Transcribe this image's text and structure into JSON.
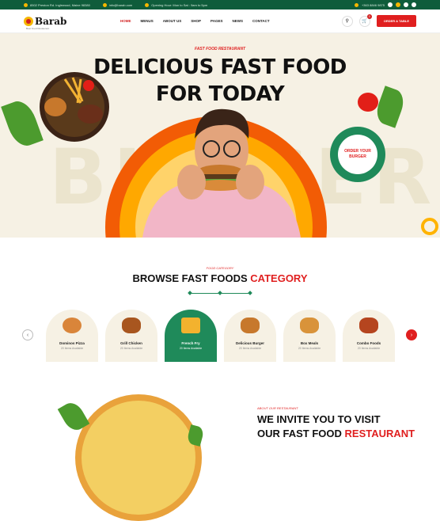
{
  "topbar": {
    "address": "8502 Preston Rd. Inglewood, Maine 98380",
    "email": "info@barab.com",
    "hours": "Opening Hour: Mon to Sat : 9am to 5pm",
    "phone": "+363 8846 9875"
  },
  "header": {
    "logo": "Barab",
    "logo_tagline": "Best Food Restaurant",
    "nav": [
      {
        "label": "HOME",
        "active": true
      },
      {
        "label": "MENUS",
        "active": false
      },
      {
        "label": "ABOUT US",
        "active": false
      },
      {
        "label": "SHOP",
        "active": false
      },
      {
        "label": "PAGES",
        "active": false
      },
      {
        "label": "NEWS",
        "active": false
      },
      {
        "label": "CONTACT",
        "active": false
      }
    ],
    "cart_count": "0",
    "order_button": "ORDER A TABLE"
  },
  "hero": {
    "kicker": "FAST FOOD RESTAURANT",
    "title_line1": "DELICIOUS FAST FOOD",
    "title_line2": "FOR TODAY",
    "background_word": "BURGER",
    "order_badge": "ORDER YOUR BURGER"
  },
  "category": {
    "kicker": "FOOD CATEGORY",
    "title": "BROWSE FAST FOODS",
    "title_highlight": "CATEGORY",
    "items": [
      {
        "name": "Dominos Pizza",
        "count": "20 Items Available",
        "active": false
      },
      {
        "name": "Grill Chicken",
        "count": "20 Items Available",
        "active": false
      },
      {
        "name": "French Fry",
        "count": "20 Items Available",
        "active": true
      },
      {
        "name": "Delicious Burger",
        "count": "20 Items Available",
        "active": false
      },
      {
        "name": "Box Meals",
        "count": "20 Items Available",
        "active": false
      },
      {
        "name": "Combo Foods",
        "count": "20 Items Available",
        "active": false
      }
    ]
  },
  "invite": {
    "kicker": "ABOUT OUR RESTAURANT",
    "title_line1": "WE INVITE YOU TO VISIT",
    "title_line2": "OUR FAST FOOD",
    "title_highlight": "RESTAURANT"
  },
  "colors": {
    "brand_green": "#0f5c3b",
    "accent_red": "#e01f1f",
    "accent_yellow": "#f5b700",
    "cream": "#f6f1e4"
  }
}
